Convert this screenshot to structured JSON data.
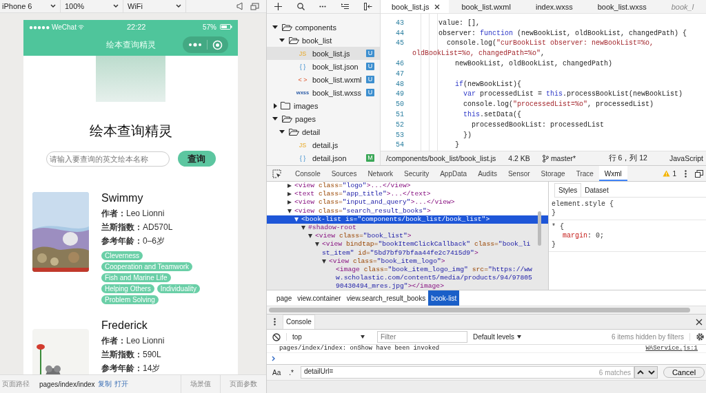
{
  "simulator": {
    "toolbar": [
      {
        "value": "iPhone 6"
      },
      {
        "value": "100%"
      },
      {
        "value": "WiFi"
      }
    ],
    "status": {
      "carrier": "●●●●● WeChat",
      "time": "22:22",
      "battery": "57%"
    },
    "nav_title": "绘本查询精灵",
    "app_title": "绘本查询精灵",
    "search": {
      "placeholder": "请输入要查询的英文绘本名称",
      "button": "查询"
    },
    "books": [
      {
        "title": "Swimmy",
        "info": [
          {
            "label": "作者：",
            "value": "Leo Lionni"
          },
          {
            "label": "兰斯指数：",
            "value": "AD570L"
          },
          {
            "label": "参考年龄：",
            "value": "0–6岁"
          }
        ],
        "tags": [
          "Cleverness",
          "Cooperation and Teamwork",
          "Fish and Marine Life",
          "Helping Others",
          "Individuality",
          "Problem Solving"
        ]
      },
      {
        "title": "Frederick",
        "info": [
          {
            "label": "作者：",
            "value": "Leo Lionni"
          },
          {
            "label": "兰斯指数：",
            "value": "590L"
          },
          {
            "label": "参考年龄：",
            "value": "14岁"
          }
        ]
      }
    ],
    "path_bar": {
      "label": "页面路径",
      "path": "pages/index/index",
      "links": [
        "复制",
        "打开"
      ],
      "right": [
        "场景值",
        "页面参数"
      ]
    }
  },
  "file_tree": {
    "items": [
      {
        "kind": "folder",
        "name": "components",
        "expanded": true,
        "selected": false,
        "children": [
          {
            "kind": "folder",
            "name": "book_list",
            "expanded": true,
            "selected": false,
            "children": [
              {
                "kind": "js",
                "name": "book_list.js",
                "icon": "JS",
                "status": "U",
                "color": "#3d8fcf",
                "selected": true
              },
              {
                "kind": "json",
                "name": "book_list.json",
                "icon": "{ }",
                "status": "U",
                "color": "#3d8fcf",
                "selected": false
              },
              {
                "kind": "wxml",
                "name": "book_list.wxml",
                "icon": "< >",
                "status": "U",
                "color": "#3d8fcf",
                "selected": false
              },
              {
                "kind": "wxss",
                "name": "book_list.wxss",
                "icon": "wxss",
                "status": "U",
                "color": "#3d8fcf",
                "selected": false
              }
            ]
          }
        ]
      },
      {
        "kind": "folder",
        "name": "images",
        "expanded": false,
        "selected": false
      },
      {
        "kind": "folder",
        "name": "pages",
        "expanded": true,
        "selected": false,
        "children": [
          {
            "kind": "folder",
            "name": "detail",
            "expanded": true,
            "selected": false,
            "children": [
              {
                "kind": "js",
                "name": "detail.js",
                "icon": "JS",
                "selected": false
              },
              {
                "kind": "json",
                "name": "detail.json",
                "icon": "{ }",
                "status": "M",
                "color": "#3aa757",
                "selected": false
              }
            ]
          }
        ]
      }
    ]
  },
  "editor": {
    "tabs": [
      {
        "label": "book_list.js",
        "selected": true,
        "preview": false
      },
      {
        "label": "book_list.wxml",
        "selected": false,
        "preview": false
      },
      {
        "label": "index.wxss",
        "selected": false,
        "preview": false
      },
      {
        "label": "book_list.wxss",
        "selected": false,
        "preview": false
      },
      {
        "label": "book_l",
        "selected": false,
        "preview": true
      }
    ],
    "lines": [
      {
        "number": "43",
        "tokens": [
          {
            "kind": "plain",
            "t": "      value: [],"
          }
        ]
      },
      {
        "number": "44",
        "tokens": [
          {
            "kind": "plain",
            "t": "      observer: "
          },
          {
            "kind": "keyword",
            "t": "function"
          },
          {
            "kind": "plain",
            "t": " (newBookList, oldBookList, changedPath) {"
          }
        ]
      },
      {
        "number": "45",
        "tokens": [
          {
            "kind": "plain",
            "t": "        console.log("
          },
          {
            "kind": "string",
            "t": "\"curBookList observer: newBookList=%o,"
          }
        ]
      },
      {
        "tokens": [
          {
            "kind": "string",
            "t": "oldBookList=%o, changedPath=%o\""
          },
          {
            "kind": "plain",
            "t": ","
          }
        ]
      },
      {
        "number": "46",
        "tokens": [
          {
            "kind": "plain",
            "t": "          newBookList, oldBookList, changedPath)"
          }
        ]
      },
      {
        "number": "47"
      },
      {
        "number": "48",
        "tokens": [
          {
            "kind": "keyword",
            "t": "          if"
          },
          {
            "kind": "plain",
            "t": "(newBookList){"
          }
        ]
      },
      {
        "number": "49",
        "tokens": [
          {
            "kind": "keyword",
            "t": "            var"
          },
          {
            "kind": "plain",
            "t": " processedList = "
          },
          {
            "kind": "keyword",
            "t": "this"
          },
          {
            "kind": "plain",
            "t": ".processBookList(newBookList)"
          }
        ]
      },
      {
        "number": "50",
        "tokens": [
          {
            "kind": "plain",
            "t": "            console.log("
          },
          {
            "kind": "string",
            "t": "\"processedList=%o\""
          },
          {
            "kind": "plain",
            "t": ", processedList)"
          }
        ]
      },
      {
        "number": "51",
        "tokens": [
          {
            "kind": "keyword",
            "t": "            this"
          },
          {
            "kind": "plain",
            "t": ".setData({"
          }
        ]
      },
      {
        "number": "52",
        "tokens": [
          {
            "kind": "plain",
            "t": "              processedBookList: processedList"
          }
        ]
      },
      {
        "number": "53",
        "tokens": [
          {
            "kind": "plain",
            "t": "            })"
          }
        ]
      },
      {
        "number": "54",
        "tokens": [
          {
            "kind": "plain",
            "t": "          }"
          }
        ]
      }
    ],
    "status": {
      "path": "/components/book_list/book_list.js",
      "size": "4.2 KB",
      "branch": "master*",
      "position": "行 6，列 12",
      "language": "JavaScript"
    }
  },
  "devtools": {
    "tabs": [
      {
        "label": "Console",
        "selected": false
      },
      {
        "label": "Sources",
        "selected": false
      },
      {
        "label": "Network",
        "selected": false
      },
      {
        "label": "Security",
        "selected": false
      },
      {
        "label": "AppData",
        "selected": false
      },
      {
        "label": "Audits",
        "selected": false
      },
      {
        "label": "Sensor",
        "selected": false
      },
      {
        "label": "Storage",
        "selected": false
      },
      {
        "label": "Trace",
        "selected": false
      },
      {
        "label": "Wxml",
        "selected": true
      }
    ],
    "warnings": "1",
    "elements": [
      {
        "text": "<view class=\"logo\">...</view>",
        "expanded": false,
        "selected": false
      },
      {
        "text": "<text class=\"app_title\">...</text>",
        "expanded": false,
        "selected": false
      },
      {
        "text": "<view class=\"input_and_query\">...</view>",
        "expanded": false,
        "selected": false
      },
      {
        "text": "<view class=\"search_result_books\">",
        "expanded": true,
        "selected": false,
        "children": [
          {
            "text": "<book-list is=\"components/book_list/book_list\">",
            "expanded": true,
            "selected": true,
            "children": [
              {
                "text": "#shadow-root",
                "expanded": true,
                "selected": false,
                "children": [
                  {
                    "text": "<view class=\"book_list\">",
                    "expanded": true,
                    "selected": false,
                    "children": [
                      {
                        "text": "<view bindtap=\"bookItemClickCallback\" class=\"book_list_item\" id=\"5bd7bf97bfaa44fe2c7415d9\">",
                        "expanded": true,
                        "selected": false,
                        "children": [
                          {
                            "text": "<view class=\"book_item_logo\">",
                            "expanded": true,
                            "selected": false,
                            "children": [
                              {
                                "text": "<image class=\"book_item_logo_img\" src=\"https://www.scholastic.com/content5/media/products/94/9780590430494_mres.jpg\"></image>",
                                "selected": false
                              }
                            ]
                          }
                        ]
                      }
                    ]
                  }
                ]
              }
            ]
          }
        ]
      }
    ],
    "styles": {
      "tabs": [
        {
          "label": "Styles",
          "selected": true
        },
        {
          "label": "Dataset",
          "selected": false
        }
      ],
      "rules": [
        {
          "open": "element.style {",
          "close": "}"
        },
        {
          "open": "* {",
          "declarations": [
            {
              "prop": "margin",
              "value": ": 0;"
            }
          ],
          "close": "}"
        }
      ]
    },
    "breadcrumb": [
      {
        "label": "page",
        "selected": false
      },
      {
        "label": "view.container",
        "selected": false
      },
      {
        "label": "view.search_result_books",
        "selected": false
      },
      {
        "label": "book-list",
        "selected": true
      }
    ]
  },
  "console": {
    "tab": "Console",
    "context": "top",
    "filter_placeholder": "Filter",
    "levels": "Default levels",
    "hidden": "6 items hidden by filters",
    "log": {
      "message": "pages/index/index: onShow have been invoked",
      "source": "WAService.js:1"
    },
    "search": {
      "case_label": "Aa",
      "regex_label": ".*",
      "value": "detailUrl=",
      "matches": "6 matches",
      "cancel": "Cancel"
    }
  }
}
